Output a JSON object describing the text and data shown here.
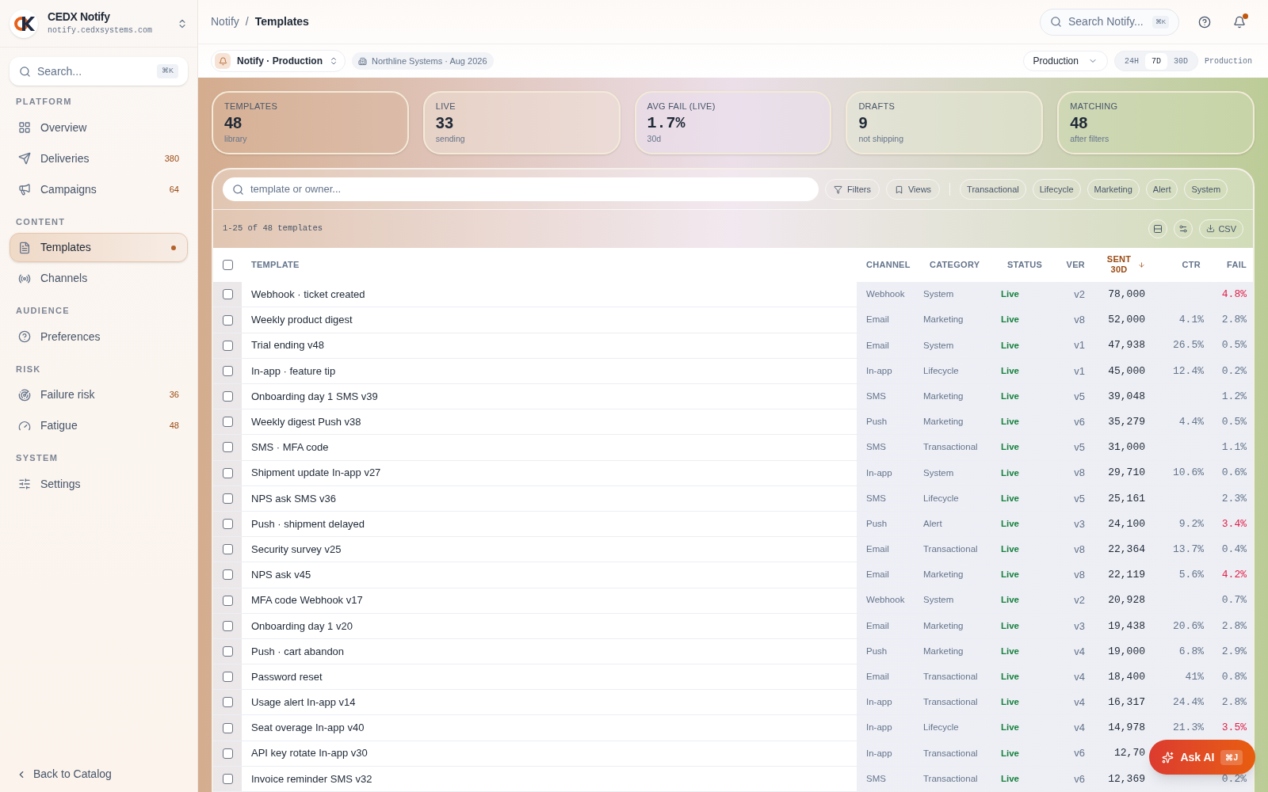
{
  "brand": {
    "name": "CEDX Notify",
    "domain": "notify.cedxsystems.com"
  },
  "sidebar": {
    "search": {
      "placeholder": "Search...",
      "shortcut": "⌘K"
    },
    "sections": [
      {
        "title": "PLATFORM",
        "items": [
          {
            "label": "Overview",
            "selected": false
          },
          {
            "label": "Deliveries",
            "count": "380",
            "selected": false
          },
          {
            "label": "Campaigns",
            "count": "64",
            "selected": false
          }
        ]
      },
      {
        "title": "CONTENT",
        "items": [
          {
            "label": "Templates",
            "selected": true
          },
          {
            "label": "Channels",
            "selected": false
          }
        ]
      },
      {
        "title": "AUDIENCE",
        "items": [
          {
            "label": "Preferences",
            "selected": false
          }
        ]
      },
      {
        "title": "RISK",
        "items": [
          {
            "label": "Failure risk",
            "count": "36",
            "selected": false
          },
          {
            "label": "Fatigue",
            "count": "48",
            "selected": false
          }
        ]
      },
      {
        "title": "SYSTEM",
        "items": [
          {
            "label": "Settings",
            "selected": false
          }
        ]
      }
    ],
    "back_link": "Back to Catalog"
  },
  "breadcrumb": [
    "Notify",
    "/",
    "Templates"
  ],
  "top_search": {
    "placeholder": "Search Notify...",
    "shortcut": "⌘K"
  },
  "notifications": {
    "unread": true
  },
  "workspace": {
    "label": "Notify · Production",
    "org": "Northline Systems · Aug 2026"
  },
  "environment": "Production",
  "ranges": [
    {
      "label": "24H",
      "selected": false
    },
    {
      "label": "7D",
      "selected": true
    },
    {
      "label": "30D",
      "selected": false
    }
  ],
  "range_env": "Production",
  "stats": [
    {
      "label": "TEMPLATES",
      "value": "48",
      "sub": "library"
    },
    {
      "label": "LIVE",
      "value": "33",
      "sub": "sending"
    },
    {
      "label": "AVG FAIL (LIVE)",
      "value": "1.7%",
      "sub": "30d"
    },
    {
      "label": "DRAFTS",
      "value": "9",
      "sub": "not shipping"
    },
    {
      "label": "MATCHING",
      "value": "48",
      "sub": "after filters"
    }
  ],
  "filter_search": {
    "placeholder": "template or owner..."
  },
  "filter_buttons": [
    "Filters",
    "Views"
  ],
  "chips": [
    {
      "label": "Transactional",
      "selected": false
    },
    {
      "label": "Lifecycle",
      "selected": false
    },
    {
      "label": "Marketing",
      "selected": false
    },
    {
      "label": "Alert",
      "selected": false
    },
    {
      "label": "System",
      "selected": false
    }
  ],
  "count_text": "1-25 of 48 templates",
  "export_label": "CSV",
  "table": {
    "all_checked": false,
    "columns": [
      {
        "label": "TEMPLATE",
        "sorted": false
      },
      {
        "label": "CHANNEL",
        "sorted": false
      },
      {
        "label": "CATEGORY",
        "sorted": false
      },
      {
        "label": "STATUS",
        "sorted": false
      },
      {
        "label": "VER",
        "sorted": false
      },
      {
        "label": "SENT 30D",
        "sorted": true
      },
      {
        "label": "CTR",
        "sorted": false
      },
      {
        "label": "FAIL",
        "sorted": false
      }
    ],
    "rows": [
      {
        "checked": false,
        "name": "Webhook · ticket created",
        "channel": "Webhook",
        "category": "System",
        "status": "Live",
        "ver": "v2",
        "sent": "78,000",
        "fail": "4.8%",
        "fail_high": true
      },
      {
        "checked": false,
        "name": "Weekly product digest",
        "channel": "Email",
        "category": "Marketing",
        "status": "Live",
        "ver": "v8",
        "sent": "52,000",
        "ctr": "4.1%",
        "fail": "2.8%",
        "fail_high": false
      },
      {
        "checked": false,
        "name": "Trial ending v48",
        "channel": "Email",
        "category": "System",
        "status": "Live",
        "ver": "v1",
        "sent": "47,938",
        "ctr": "26.5%",
        "fail": "0.5%",
        "fail_high": false
      },
      {
        "checked": false,
        "name": "In-app · feature tip",
        "channel": "In-app",
        "category": "Lifecycle",
        "status": "Live",
        "ver": "v1",
        "sent": "45,000",
        "ctr": "12.4%",
        "fail": "0.2%",
        "fail_high": false
      },
      {
        "checked": false,
        "name": "Onboarding day 1 SMS v39",
        "channel": "SMS",
        "category": "Marketing",
        "status": "Live",
        "ver": "v5",
        "sent": "39,048",
        "fail": "1.2%",
        "fail_high": false
      },
      {
        "checked": false,
        "name": "Weekly digest Push v38",
        "channel": "Push",
        "category": "Marketing",
        "status": "Live",
        "ver": "v6",
        "sent": "35,279",
        "ctr": "4.4%",
        "fail": "0.5%",
        "fail_high": false
      },
      {
        "checked": false,
        "name": "SMS · MFA code",
        "channel": "SMS",
        "category": "Transactional",
        "status": "Live",
        "ver": "v5",
        "sent": "31,000",
        "fail": "1.1%",
        "fail_high": false
      },
      {
        "checked": false,
        "name": "Shipment update In-app v27",
        "channel": "In-app",
        "category": "System",
        "status": "Live",
        "ver": "v8",
        "sent": "29,710",
        "ctr": "10.6%",
        "fail": "0.6%",
        "fail_high": false
      },
      {
        "checked": false,
        "name": "NPS ask SMS v36",
        "channel": "SMS",
        "category": "Lifecycle",
        "status": "Live",
        "ver": "v5",
        "sent": "25,161",
        "fail": "2.3%",
        "fail_high": false
      },
      {
        "checked": false,
        "name": "Push · shipment delayed",
        "channel": "Push",
        "category": "Alert",
        "status": "Live",
        "ver": "v3",
        "sent": "24,100",
        "ctr": "9.2%",
        "fail": "3.4%",
        "fail_high": true
      },
      {
        "checked": false,
        "name": "Security survey v25",
        "channel": "Email",
        "category": "Transactional",
        "status": "Live",
        "ver": "v8",
        "sent": "22,364",
        "ctr": "13.7%",
        "fail": "0.4%",
        "fail_high": false
      },
      {
        "checked": false,
        "name": "NPS ask v45",
        "channel": "Email",
        "category": "Marketing",
        "status": "Live",
        "ver": "v8",
        "sent": "22,119",
        "ctr": "5.6%",
        "fail": "4.2%",
        "fail_high": true
      },
      {
        "checked": false,
        "name": "MFA code Webhook v17",
        "channel": "Webhook",
        "category": "System",
        "status": "Live",
        "ver": "v2",
        "sent": "20,928",
        "fail": "0.7%",
        "fail_high": false
      },
      {
        "checked": false,
        "name": "Onboarding day 1 v20",
        "channel": "Email",
        "category": "Marketing",
        "status": "Live",
        "ver": "v3",
        "sent": "19,438",
        "ctr": "20.6%",
        "fail": "2.8%",
        "fail_high": false
      },
      {
        "checked": false,
        "name": "Push · cart abandon",
        "channel": "Push",
        "category": "Marketing",
        "status": "Live",
        "ver": "v4",
        "sent": "19,000",
        "ctr": "6.8%",
        "fail": "2.9%",
        "fail_high": false
      },
      {
        "checked": false,
        "name": "Password reset",
        "channel": "Email",
        "category": "Transactional",
        "status": "Live",
        "ver": "v4",
        "sent": "18,400",
        "ctr": "41%",
        "fail": "0.8%",
        "fail_high": false
      },
      {
        "checked": false,
        "name": "Usage alert In-app v14",
        "channel": "In-app",
        "category": "Transactional",
        "status": "Live",
        "ver": "v4",
        "sent": "16,317",
        "ctr": "24.4%",
        "fail": "2.8%",
        "fail_high": false
      },
      {
        "checked": false,
        "name": "Seat overage In-app v40",
        "channel": "In-app",
        "category": "Lifecycle",
        "status": "Live",
        "ver": "v4",
        "sent": "14,978",
        "ctr": "21.3%",
        "fail": "3.5%",
        "fail_high": true
      },
      {
        "checked": false,
        "name": "API key rotate In-app v30",
        "channel": "In-app",
        "category": "Transactional",
        "status": "Live",
        "ver": "v6",
        "sent": "12,70"
      },
      {
        "checked": false,
        "name": "Invoice reminder SMS v32",
        "channel": "SMS",
        "category": "Transactional",
        "status": "Live",
        "ver": "v6",
        "sent": "12,369",
        "fail": "0.2%",
        "fail_high": false
      }
    ]
  },
  "ask_ai": {
    "label": "Ask AI",
    "shortcut": "⌘J"
  }
}
